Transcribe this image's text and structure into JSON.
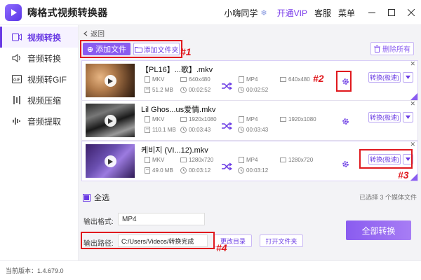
{
  "app": {
    "title": "嗨格式视频转换器"
  },
  "header": {
    "user": "小嗨同学",
    "vip": "开通VIP",
    "service": "客服",
    "menu": "菜单"
  },
  "sidebar": {
    "items": [
      {
        "label": "视频转换",
        "icon": "video-icon",
        "active": true
      },
      {
        "label": "音频转换",
        "icon": "audio-icon"
      },
      {
        "label": "视频转GIF",
        "icon": "gif-icon"
      },
      {
        "label": "视频压缩",
        "icon": "compress-icon"
      },
      {
        "label": "音频提取",
        "icon": "extract-icon"
      }
    ]
  },
  "toolbar": {
    "back": "返回",
    "add_file": "添加文件",
    "add_folder": "添加文件夹",
    "delete_all": "删除所有"
  },
  "annotations": [
    "#1",
    "#2",
    "#3",
    "#4"
  ],
  "files": [
    {
      "name": "【PL16】...歌】.mkv",
      "src_format": "MKV",
      "src_res": "640x480",
      "src_size": "51.2 MB",
      "src_duration": "00:02:52",
      "dst_format": "MP4",
      "dst_res": "640x480",
      "dst_duration": "00:02:52",
      "convert_label": "转换(极速)"
    },
    {
      "name": "Lil Ghos...us爱情.mkv",
      "src_format": "MKV",
      "src_res": "1920x1080",
      "src_size": "110.1 MB",
      "src_duration": "00:03:43",
      "dst_format": "MP4",
      "dst_res": "1920x1080",
      "dst_duration": "00:03:43",
      "convert_label": "转换(极速)"
    },
    {
      "name": "케비지 (VI...12).mkv",
      "src_format": "MKV",
      "src_res": "1280x720",
      "src_size": "49.0 MB",
      "src_duration": "00:03:12",
      "dst_format": "MP4",
      "dst_res": "1280x720",
      "dst_duration": "00:03:12",
      "convert_label": "转换(极速)"
    }
  ],
  "bottom": {
    "select_all": "全选",
    "selected_info": "已选择 3 个媒体文件",
    "format_label": "输出格式:",
    "format_value": "MP4",
    "path_label": "输出路径:",
    "path_value": "C:/Users/Videos/转换完成",
    "change_dir": "更改目录",
    "open_folder": "打开文件夹",
    "convert_all": "全部转换"
  },
  "footer": {
    "version_label": "当前版本：",
    "version": "1.4.679.0"
  }
}
